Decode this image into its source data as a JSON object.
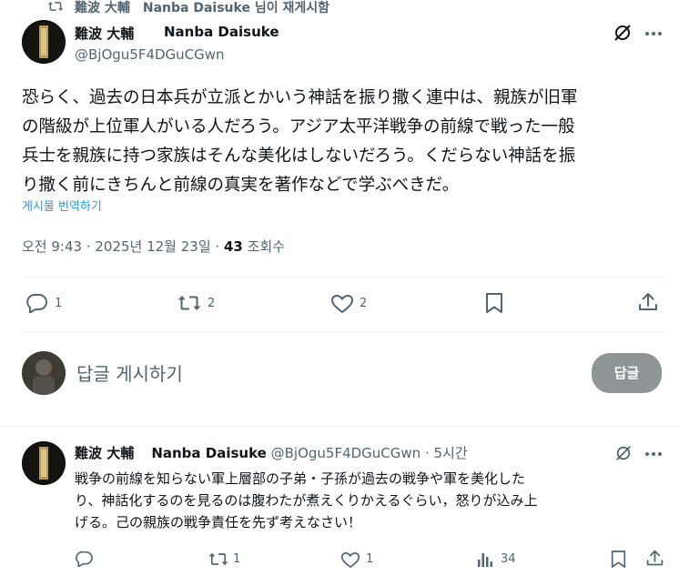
{
  "repost_banner": {
    "text": "難波 大輔　Nanba Daisuke 님이 재게시함"
  },
  "main_tweet": {
    "display_name": "難波 大輔",
    "display_name_en": "Nanba Daisuke",
    "handle": "@BjOgu5F4DGuCGwn",
    "body_lines": [
      "恐らく、過去の日本兵が立派とかいう神話を振り撒く連中は、親族が旧軍",
      "の階級が上位軍人がいる人だろう。アジア太平洋戦争の前線で戦った一般",
      "兵士を親族に持つ家族はそんな美化はしないだろう。くだらない神話を振",
      "り撒く前にきちんと前線の真実を著作などで学ぶべきだ。"
    ],
    "translate_link": "게시물 번역하기",
    "timestamp": "오전 9:43 · 2025년 12월 23일 · ",
    "views_count": "43",
    "views_label": " 조회수",
    "actions": {
      "reply_count": "1",
      "repost_count": "2",
      "like_count": "2"
    },
    "icons": [
      "grok-icon",
      "more-icon",
      "reply-icon",
      "repost-icon",
      "like-icon",
      "bookmark-icon",
      "share-icon"
    ]
  },
  "reply_composer": {
    "placeholder": "답글 게시하기",
    "button_label": "답글"
  },
  "reply_tweet": {
    "display_name": "難波 大輔",
    "display_name_en": "Nanba Daisuke",
    "handle_time": "@BjOgu5F4DGuCGwn · 5시간",
    "body_lines": [
      "戦争の前線を知らない軍上層部の子弟・子孫が過去の戦争や軍を美化した",
      "り、神話化するのを見るのは腹わたが煮えくりかえるぐらい，怒りが込み上",
      "げる。己の親族の戦争責任を先ず考えなさい！"
    ],
    "actions": {
      "reply_count": "",
      "repost_count": "1",
      "like_count": "1",
      "views_count": "34"
    }
  },
  "colors": {
    "text": "#0f1419",
    "muted": "#536471",
    "link": "#1d9bf0",
    "divider": "#eff3f4",
    "reply_button": "#8f9497"
  }
}
